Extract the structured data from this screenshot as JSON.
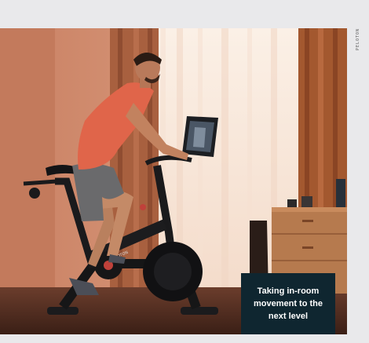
{
  "photo": {
    "subject_icon": "rider-on-spin-bike-icon",
    "bike_brand": "PELOTON",
    "photo_credit": "PELOTON"
  },
  "caption": {
    "text": "Taking in-room movement to the next level"
  },
  "colors": {
    "page_background": "#e9e9eb",
    "caption_background": "#0f2630",
    "caption_text": "#ffffff",
    "shirt": "#e0654a",
    "wall": "#c98d6a"
  }
}
